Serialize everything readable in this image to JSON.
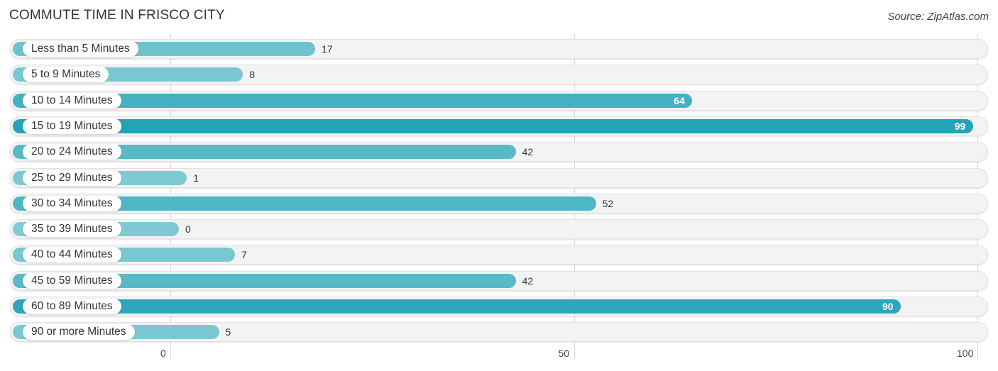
{
  "chart_data": {
    "type": "bar",
    "orientation": "horizontal",
    "title": "COMMUTE TIME IN FRISCO CITY",
    "source": "Source: ZipAtlas.com",
    "categories": [
      "Less than 5 Minutes",
      "5 to 9 Minutes",
      "10 to 14 Minutes",
      "15 to 19 Minutes",
      "20 to 24 Minutes",
      "25 to 29 Minutes",
      "30 to 34 Minutes",
      "35 to 39 Minutes",
      "40 to 44 Minutes",
      "45 to 59 Minutes",
      "60 to 89 Minutes",
      "90 or more Minutes"
    ],
    "values": [
      17,
      8,
      64,
      99,
      42,
      1,
      52,
      0,
      7,
      42,
      90,
      5
    ],
    "value_labels": [
      "17",
      "8",
      "64",
      "99",
      "42",
      "1",
      "52",
      "0",
      "7",
      "42",
      "90",
      "5"
    ],
    "xlim": [
      0,
      100
    ],
    "xticks": [
      0,
      50,
      100
    ],
    "xtick_labels": [
      "0",
      "50",
      "100"
    ],
    "xlabel": "",
    "ylabel": "",
    "grid": true,
    "colors": {
      "low": "#7fcad4",
      "high": "#23a3b6",
      "track": "#f3f3f3"
    }
  }
}
